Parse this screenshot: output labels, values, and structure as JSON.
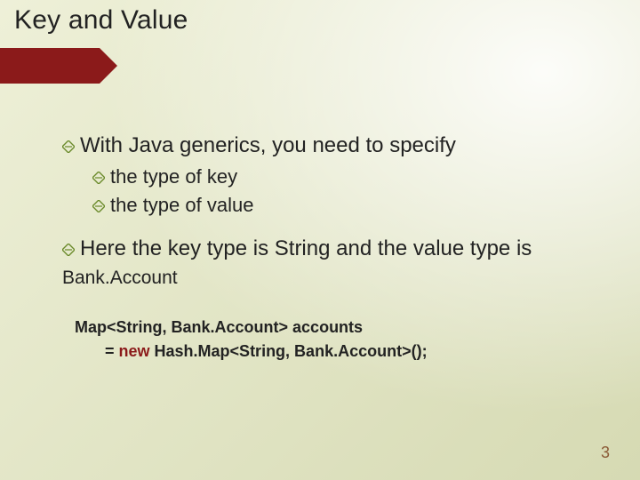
{
  "title": "Key and Value",
  "bullets": {
    "b1": "With Java generics, you need to specify",
    "b1a": "the type of key",
    "b1b": "the type of value",
    "b2_prefix": "Here the key type is String and the value type is ",
    "b2_code": "Bank.Account"
  },
  "code": {
    "line1": "Map<String, Bank.Account> accounts",
    "line2_prefix": "= ",
    "line2_kw": "new",
    "line2_rest": " Hash.Map<String, Bank.Account>();"
  },
  "page_number": "3"
}
